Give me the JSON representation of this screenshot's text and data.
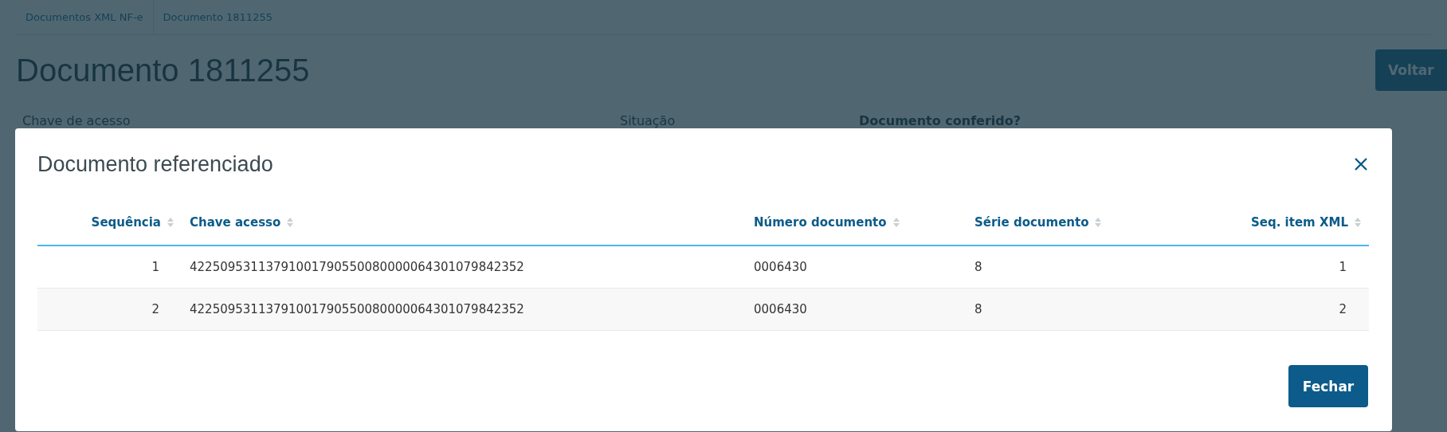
{
  "breadcrumbs": [
    {
      "label": "Documentos XML NF-e"
    },
    {
      "label": "Documento 1811255"
    }
  ],
  "page": {
    "title": "Documento 1811255",
    "back_button": "Voltar",
    "fields": [
      "Chave de acesso",
      "Situação",
      "Documento conferido?"
    ]
  },
  "modal": {
    "title": "Documento referenciado",
    "columns": [
      "Sequência",
      "Chave acesso",
      "Número documento",
      "Série documento",
      "Seq. item XML"
    ],
    "rows": [
      [
        "1",
        "42250953113791001790550080000064301079842352",
        "0006430",
        "8",
        "1"
      ],
      [
        "2",
        "42250953113791001790550080000064301079842352",
        "0006430",
        "8",
        "2"
      ]
    ],
    "close_button": "Fechar"
  }
}
